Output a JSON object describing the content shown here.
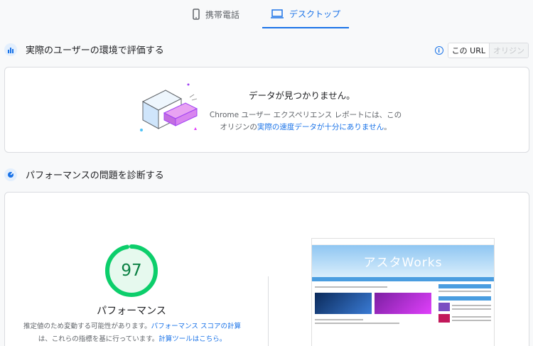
{
  "tabs": {
    "mobile_label": "携帯電話",
    "desktop_label": "デスクトップ"
  },
  "field_section": {
    "title": "実際のユーザーの環境で評価する",
    "url_toggle": {
      "on": "この URL",
      "off": "オリジン"
    },
    "no_data_title": "データが見つかりません。",
    "no_data_text_1": "Chrome ユーザー エクスペリエンス レポートには、この",
    "no_data_text_2": "オリジンの",
    "no_data_link": "実際の速度データが十分にありません",
    "no_data_text_3": "。"
  },
  "diagnose_section": {
    "title": "パフォーマンスの問題を診断する",
    "score": "97",
    "score_fraction": 0.97,
    "score_label": "パフォーマンス",
    "desc_1": "推定値のため変動する可能性があります。",
    "desc_link_1": "パフォーマンス スコアの計算",
    "desc_2": "は、これらの指標を基に行っています。",
    "desc_link_2": "計算ツールはこちら。"
  },
  "thumbnail": {
    "logo": "アスタWorks"
  },
  "colors": {
    "accent": "#1a73e8",
    "score_good": "#0cce6b",
    "score_text": "#0b8043"
  }
}
